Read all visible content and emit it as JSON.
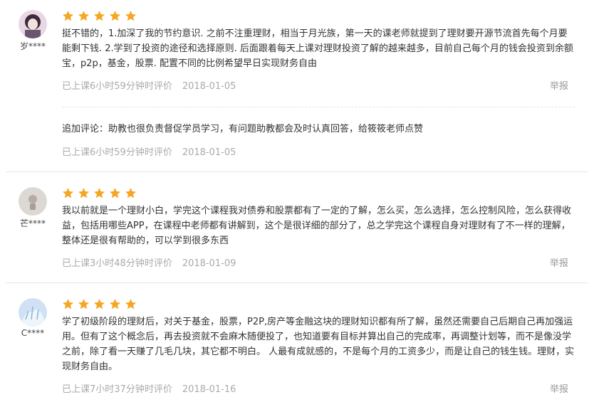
{
  "colors": {
    "star": "#f5a623",
    "meta_text": "#aaaaaa",
    "report_text": "#999999"
  },
  "reviews": [
    {
      "username": "岁****",
      "rating": 5,
      "content": "挺不错的，1.加深了我的节约意识. 之前不注重理财，相当于月光族，第一天的课老师就提到了理财要开源节流首先每个月要能剩下钱. 2.学到了投资的途径和选择原则. 后面跟着每天上课对理财投资了解的越来越多，目前自己每个月的钱会投资到余额宝，p2p，基金，股票. 配置不同的比例希望早日实现财务自由",
      "status": "已上课6小时59分钟时评价",
      "date": "2018-01-05",
      "report": "举报",
      "followup": {
        "content": "追加评论：助教也很负责督促学员学习，有问题助教都会及时认真回答，给筱筱老师点赞",
        "status": "已上课6小时59分钟时评价",
        "date": "2018-01-05"
      }
    },
    {
      "username": "芒****",
      "rating": 5,
      "content": "我以前就是一个理财小白，学完这个课程我对债券和股票都有了一定的了解，怎么买，怎么选择，怎么控制风险，怎么获得收益，包括用哪些APP，在课程中老师都有讲解到，这个是很详细的部分了，总之学完这个课程自身对理财有了不一样的理解，整体还是很有帮助的，可以学到很多东西",
      "status": "已上课3小时48分钟时评价",
      "date": "2018-01-09",
      "report": "举报"
    },
    {
      "username": "C****",
      "rating": 5,
      "content": "学了初级阶段的理财后，对关于基金，股票，P2P,房产等金融这块的理财知识都有所了解，虽然还需要自己后期自己再加强运用。但有了这个概念后，再去投资就不会麻木随便投了，也知道要有目标并算出自己的完成率，再调整计划等，而不是像没学之前，除了看一天赚了几毛几块，其它都不明白。 人最有成就感的，不是每个月的工资多少，而是让自己的钱生钱。理财，实现财务自由。",
      "status": "已上课7小时37分钟时评价",
      "date": "2018-01-16",
      "report": "举报"
    }
  ]
}
